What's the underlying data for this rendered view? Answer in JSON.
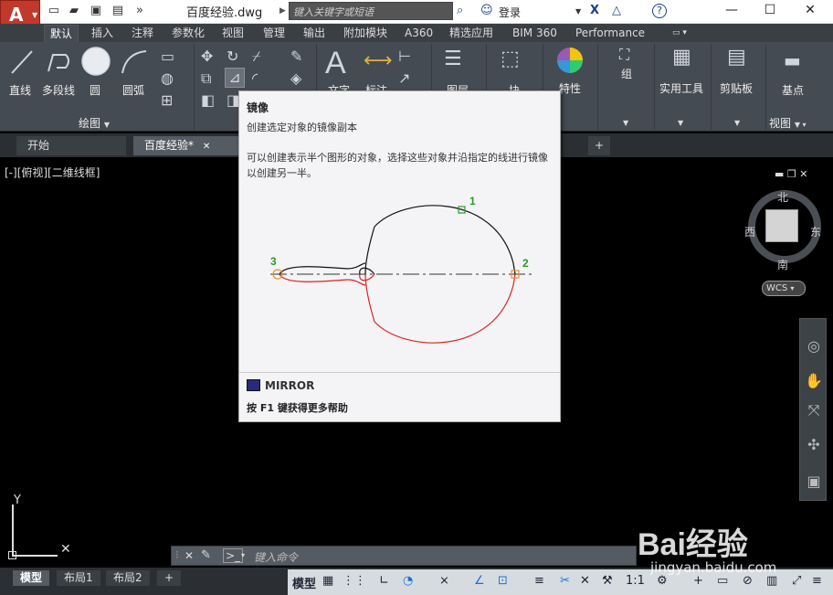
{
  "title_bar": {
    "document_title": "百度经验.dwg",
    "search_placeholder": "键入关键字或短语",
    "login_label": "登录"
  },
  "ribbon_tabs": [
    "默认",
    "插入",
    "注释",
    "参数化",
    "视图",
    "管理",
    "输出",
    "附加模块",
    "A360",
    "精选应用",
    "BIM 360",
    "Performance"
  ],
  "ribbon": {
    "draw_tools": [
      "直线",
      "多段线",
      "圆",
      "圆弧"
    ],
    "draw_panel_label": "绘图",
    "text_label": "文字",
    "annotate_label": "标注",
    "layer_label": "图层",
    "block_label": "块",
    "properties_label": "特性",
    "group_label": "组",
    "utilities_label": "实用工具",
    "clipboard_label": "剪贴板",
    "base_label": "基点",
    "view_panel_label": "视图"
  },
  "file_tabs": [
    "开始",
    "百度经验*"
  ],
  "drawing": {
    "view_label": "[-][俯视][二维线框]"
  },
  "viewcube": {
    "north": "北",
    "south": "南",
    "east": "东",
    "west": "西",
    "wcs_label": "WCS"
  },
  "tooltip": {
    "title": "镜像",
    "short_desc": "创建选定对象的镜像副本",
    "long_desc": "可以创建表示半个图形的对象，选择这些对象并沿指定的线进行镜像以创建另一半。",
    "point_labels": [
      "1",
      "2",
      "3"
    ],
    "command_name": "MIRROR",
    "help_text": "按 F1 键获得更多帮助"
  },
  "command_line": {
    "placeholder": "键入命令"
  },
  "status_bar": {
    "layout_tabs": [
      "模型",
      "布局1",
      "布局2"
    ],
    "model_label": "模型",
    "scale_label": "1:1"
  },
  "watermark": {
    "logo": "Bai经验",
    "url": "jingyan.baidu.com"
  },
  "colors": {
    "ribbon_bg": "#454b52",
    "tab_bar_bg": "#3a3f44",
    "drawing_bg": "#000000",
    "autocad_red": "#c0392b",
    "accent_blue": "#1e6fd6",
    "mirror_line_red": "#e02020",
    "point_green": "#2a9a2a"
  }
}
